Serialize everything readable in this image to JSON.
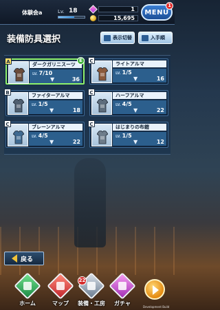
{
  "player": {
    "name": "体験会a",
    "level_label": "Lv.",
    "level": "18",
    "exp_progress": 0.6,
    "gems": "1",
    "coins": "15,695"
  },
  "menu": {
    "label": "MENU",
    "badge": "1"
  },
  "header": {
    "title": "装備防具選択",
    "sort_label": "表示切替",
    "acquire_label": "入手順"
  },
  "items": [
    {
      "rank": "A",
      "name": "ダークガリニスーツ",
      "level": "7/10",
      "defense": "36",
      "equipped": true,
      "equip_mark": "E",
      "armor_color": "#6b4c3a"
    },
    {
      "rank": "C",
      "name": "ライトアルマ",
      "level": "1/5",
      "defense": "16",
      "equipped": false,
      "armor_color": "#8a5a3c"
    },
    {
      "rank": "B",
      "name": "ファイターアルマ",
      "level": "1/5",
      "defense": "18",
      "equipped": false,
      "armor_color": "#4f5f70"
    },
    {
      "rank": "C",
      "name": "ハーフアルマ",
      "level": "4/5",
      "defense": "22",
      "equipped": false,
      "armor_color": "#5d6d7c"
    },
    {
      "rank": "C",
      "name": "ブレーンアルマ",
      "level": "4/5",
      "defense": "22",
      "equipped": false,
      "armor_color": "#3f6a91"
    },
    {
      "rank": "C",
      "name": "はじまりの布鎧",
      "level": "1/5",
      "defense": "12",
      "equipped": false,
      "armor_color": "#6e7d8b"
    }
  ],
  "item_lv_prefix": "LV.",
  "back": {
    "label": "戻る"
  },
  "nav": {
    "home": "ホーム",
    "map": "マップ",
    "craft": "装備・工房",
    "craft_badge": "22",
    "gacha": "ガチャ"
  },
  "build_label": "Development Build"
}
